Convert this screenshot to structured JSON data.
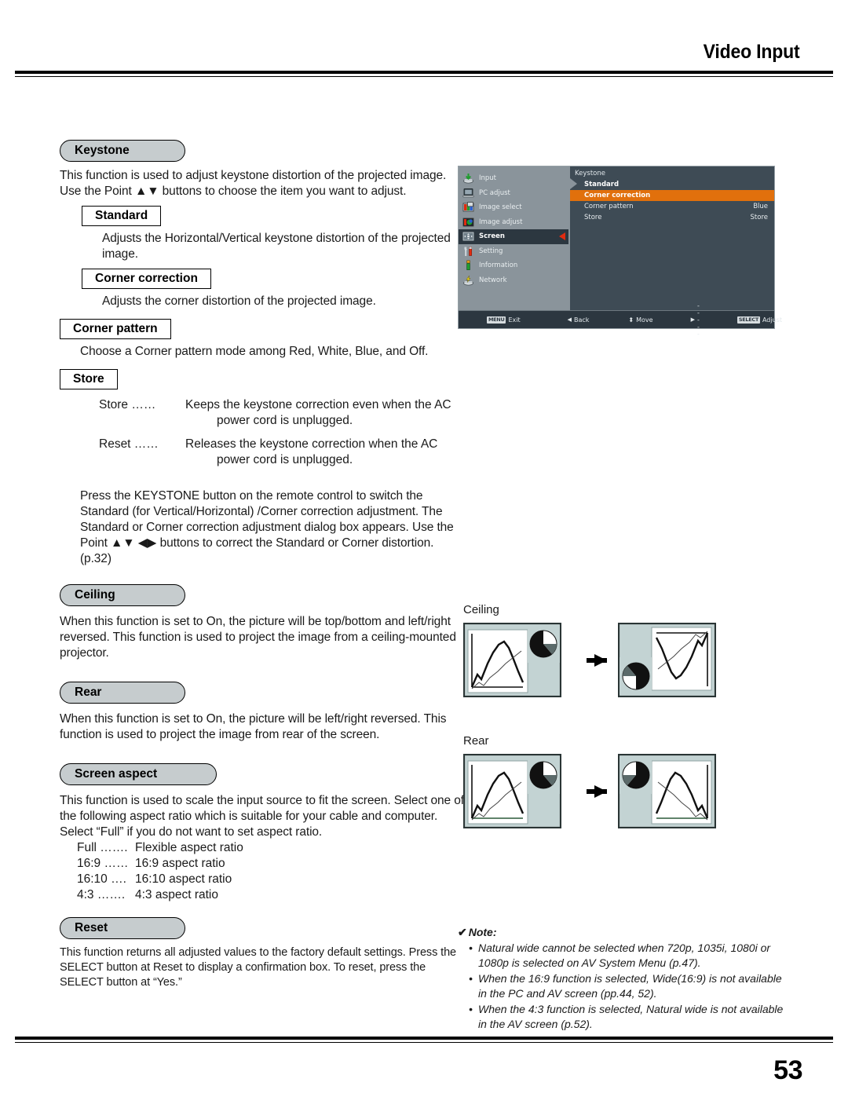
{
  "header": {
    "title": "Video Input"
  },
  "footer": {
    "page_number": "53"
  },
  "sections": {
    "keystone": {
      "heading": "Keystone",
      "intro": "This function is used to adjust keystone distortion of the projected image. Use the Point ▲▼ buttons to choose the item you want to adjust.",
      "standard": {
        "heading": "Standard",
        "text": "Adjusts the Horizontal/Vertical keystone distortion of the projected image."
      },
      "corner_correction": {
        "heading": "Corner correction",
        "text": "Adjusts the corner distortion of the projected image."
      },
      "corner_pattern": {
        "heading": "Corner pattern",
        "text": "Choose a Corner pattern mode among Red, White, Blue, and Off."
      },
      "store": {
        "heading": "Store",
        "rows": [
          {
            "term": "Store ……",
            "desc": "Keeps the keystone correction even when the AC",
            "cont": "power cord is unplugged."
          },
          {
            "term": "Reset ……",
            "desc": "Releases the keystone correction when the AC",
            "cont": "power cord is unplugged."
          }
        ]
      },
      "keystone_note": "Press the KEYSTONE button on the remote control to switch the Standard (for Vertical/Horizontal) /Corner correction adjustment. The Standard or Corner correction adjustment dialog box appears. Use the Point  ▲▼ ◀▶ buttons to correct the Standard or Corner distortion.  (p.32)"
    },
    "ceiling": {
      "heading": "Ceiling",
      "text": "When this function is set to On, the picture will be top/bottom and left/right reversed. This function is used to project the image from a ceiling-mounted projector."
    },
    "rear": {
      "heading": "Rear",
      "text": "When this function is set to On, the picture will be left/right reversed. This function is used to project the image from rear of the screen."
    },
    "screen_aspect": {
      "heading": "Screen aspect",
      "text": "This function is used to scale the input source to fit the screen. Select one of the following aspect ratio which is suitable for your cable and computer. Select “Full” if you do not want to set aspect ratio.",
      "options": [
        {
          "term": "Full …….",
          "desc": "Flexible aspect ratio"
        },
        {
          "term": "16:9 ……",
          "desc": "16:9 aspect ratio"
        },
        {
          "term": "16:10 ….",
          "desc": "16:10 aspect ratio"
        },
        {
          "term": "4:3 …….",
          "desc": "4:3 aspect ratio"
        }
      ]
    },
    "reset": {
      "heading": "Reset",
      "text": "This function returns all adjusted values to the factory default settings. Press the SELECT button at Reset to display a confirmation box. To reset, press the SELECT button at “Yes.”"
    }
  },
  "osd": {
    "sidebar": [
      {
        "label": "Input",
        "icon": "input-icon",
        "active": false
      },
      {
        "label": "PC adjust",
        "icon": "pc-adjust-icon",
        "active": false
      },
      {
        "label": "Image select",
        "icon": "image-select-icon",
        "active": false
      },
      {
        "label": "Image adjust",
        "icon": "image-adjust-icon",
        "active": false
      },
      {
        "label": "Screen",
        "icon": "screen-icon",
        "active": true
      },
      {
        "label": "Setting",
        "icon": "setting-icon",
        "active": false
      },
      {
        "label": "Information",
        "icon": "information-icon",
        "active": false
      },
      {
        "label": "Network",
        "icon": "network-icon",
        "active": false
      }
    ],
    "panel_title": "Keystone",
    "rows": [
      {
        "label": "Standard",
        "value": "",
        "selected": false,
        "first": true
      },
      {
        "label": "Corner correction",
        "value": "",
        "selected": true,
        "first": false
      },
      {
        "label": "Corner pattern",
        "value": "Blue",
        "selected": false,
        "first": false
      },
      {
        "label": "Store",
        "value": "Store",
        "selected": false,
        "first": false
      }
    ],
    "bottom_bar": [
      {
        "key": "MENU",
        "label": "Exit"
      },
      {
        "key": "",
        "label": "Back",
        "glyph": "◀"
      },
      {
        "key": "",
        "label": "Move",
        "glyph": "⬍"
      },
      {
        "key": "",
        "label": "-----",
        "glyph": "▶"
      },
      {
        "key": "SELECT",
        "label": "Adjust"
      }
    ],
    "colors": {
      "sidebar_bg": "#8a949b",
      "panel_bg": "#3e4b55",
      "highlight": "#e1700c",
      "active_item": "#2c3740",
      "arrow_red": "#e02b10"
    }
  },
  "illustrations": {
    "ceiling_label": "Ceiling",
    "rear_label": "Rear"
  },
  "note": {
    "title": "Note:",
    "check": "✔",
    "items": [
      "Natural wide cannot be selected when 720p, 1035i, 1080i or 1080p is selected on AV System Menu (p.47).",
      "When the 16:9 function is selected, Wide(16:9) is not available in the PC and AV screen (pp.44, 52).",
      "When the 4:3 function is selected, Natural wide is not available in the AV screen (p.52)."
    ]
  }
}
